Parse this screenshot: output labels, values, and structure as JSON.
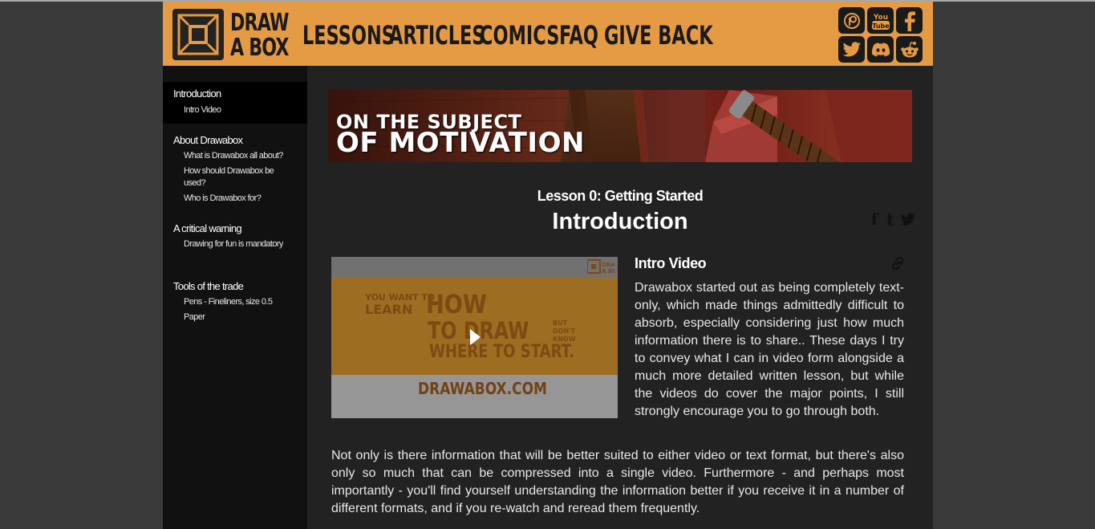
{
  "header": {
    "logo": {
      "line1": "DRAW",
      "line2": "A BOX"
    },
    "nav": [
      {
        "label": "LESSONS"
      },
      {
        "label": "ARTICLES"
      },
      {
        "label": "COMICS"
      },
      {
        "label": "FAQ"
      },
      {
        "label": "GIVE BACK"
      }
    ],
    "social": [
      "patreon-icon",
      "youtube-icon",
      "facebook-icon",
      "twitter-icon",
      "discord-icon",
      "reddit-icon"
    ]
  },
  "sidebar": {
    "sections": [
      {
        "heading": "Introduction",
        "items": [
          "Intro Video"
        ]
      },
      {
        "heading": "About Drawabox",
        "items": [
          "What is Drawabox all about?",
          "How should Drawabox be used?",
          "Who is Drawabox for?"
        ]
      },
      {
        "heading": "A critical warning",
        "items": [
          "Drawing for fun is mandatory"
        ]
      },
      {
        "heading": "Tools of the trade",
        "items": [
          "Pens - Fineliners, size 0.5",
          "Paper"
        ]
      }
    ]
  },
  "banner": {
    "line1": "ON THE SUBJECT",
    "line2": "OF MOTIVATION"
  },
  "lesson": {
    "subtitle": "Lesson 0: Getting Started",
    "title": "Introduction",
    "share": {
      "facebook": "f",
      "tumblr": "t"
    }
  },
  "video": {
    "thumb_text": {
      "you_want_to": "YOU WANT TO",
      "learn": "LEARN",
      "how": "HOW",
      "to_draw": "TO DRAW",
      "but_dont_know": "BUT DON'T KNOW",
      "where_to_start": "WHERE TO START.",
      "site": "DRAWABOX.COM"
    }
  },
  "section": {
    "title": "Intro Video",
    "para1": "Drawabox started out as being completely text-only, which made things admittedly difficult to absorb, especially considering just how much information there is to share.. These days I try to convey what I can in video form alongside a much more detailed written lesson, but while the videos do cover the major points, I still strongly encourage you to go through both.",
    "para2": "Not only is there information that will be better suited to either video or text format, but there's also only so much that can be compressed into a single video. Furthermore - and perhaps most importantly - you'll find yourself understanding the information better if you receive it in a number of different formats, and if you re-watch and reread them frequently."
  },
  "colors": {
    "header": "#e59a44",
    "sidebar": "#111111",
    "main": "#222222",
    "outer": "#3a3a3a"
  }
}
